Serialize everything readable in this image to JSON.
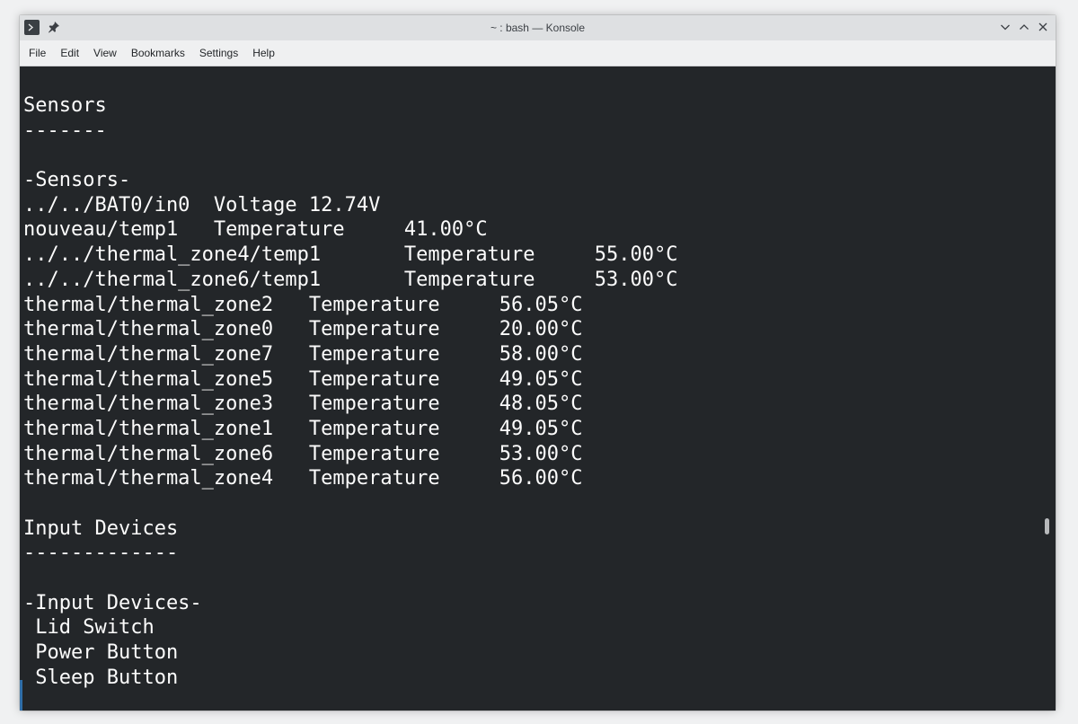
{
  "window": {
    "title": "~ : bash — Konsole"
  },
  "menubar": {
    "items": [
      "File",
      "Edit",
      "View",
      "Bookmarks",
      "Settings",
      "Help"
    ]
  },
  "terminal": {
    "lines": [
      "Sensors",
      "-------",
      "",
      "-Sensors-",
      "../../BAT0/in0  Voltage 12.74V",
      "nouveau/temp1   Temperature     41.00°C",
      "../../thermal_zone4/temp1       Temperature     55.00°C",
      "../../thermal_zone6/temp1       Temperature     53.00°C",
      "thermal/thermal_zone2   Temperature     56.05°C",
      "thermal/thermal_zone0   Temperature     20.00°C",
      "thermal/thermal_zone7   Temperature     58.00°C",
      "thermal/thermal_zone5   Temperature     49.05°C",
      "thermal/thermal_zone3   Temperature     48.05°C",
      "thermal/thermal_zone1   Temperature     49.05°C",
      "thermal/thermal_zone6   Temperature     53.00°C",
      "thermal/thermal_zone4   Temperature     56.00°C",
      "",
      "Input Devices",
      "-------------",
      "",
      "-Input Devices-",
      " Lid Switch",
      " Power Button",
      " Sleep Button"
    ]
  },
  "colors": {
    "terminal_bg": "#232629",
    "terminal_fg": "#fcfcfc",
    "titlebar_bg": "#dee0e2",
    "menubar_bg": "#eff0f1"
  }
}
